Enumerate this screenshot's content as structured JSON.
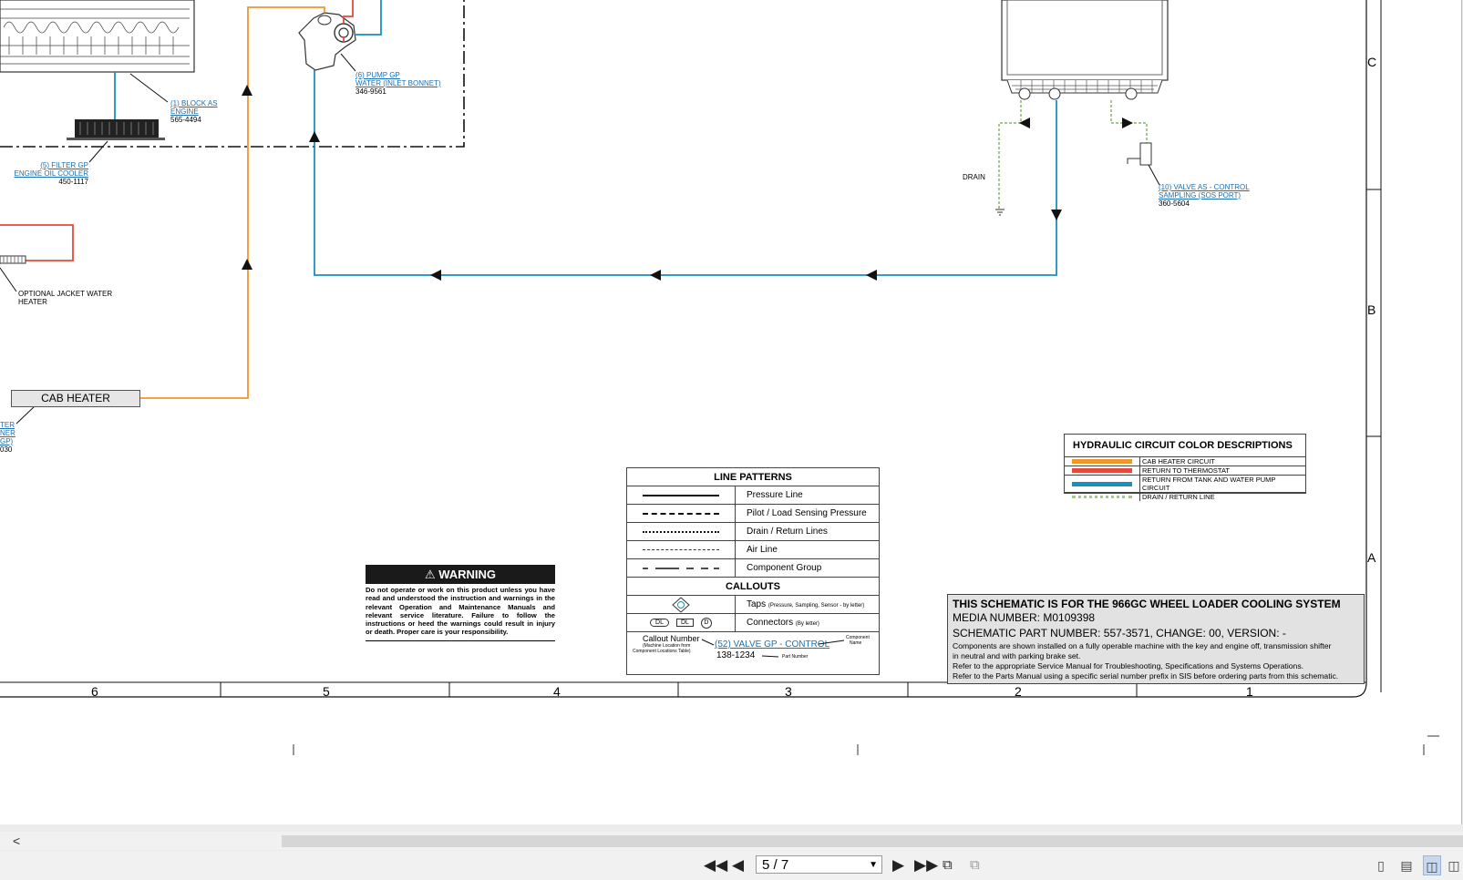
{
  "schematic": {
    "callouts": {
      "block": {
        "link": "(1) BLOCK AS",
        "link2": "ENGINE",
        "part": "565-4494"
      },
      "pump": {
        "link": "(6) PUMP GP",
        "link2": "WATER (INLET BONNET)",
        "part": "346-9561"
      },
      "filter": {
        "link": "(5) FILTER GP",
        "link2": "ENGINE OIL COOLER",
        "part": "450-1117"
      },
      "valve": {
        "link": "(10) VALVE AS - CONTROL",
        "link2": "SAMPLING (SOS PORT)",
        "part": "360-5604"
      },
      "cab_partial": {
        "l1": "TER",
        "l2": "NER",
        "l3": "GP)",
        "part": "030"
      }
    },
    "labels": {
      "drain": "DRAIN",
      "jacket_heater_1": "OPTIONAL JACKET WATER",
      "jacket_heater_2": "HEATER",
      "cab_heater": "CAB HEATER"
    },
    "zones": {
      "letters": [
        "C",
        "B",
        "A"
      ],
      "numbers": [
        "6",
        "5",
        "4",
        "3",
        "2",
        "1"
      ]
    },
    "colors": {
      "cab_heater_circuit": "#f0962b",
      "return_to_thermostat": "#e04b3c",
      "return_from_tank": "#1b8fbd",
      "drain_return": "#a6c78f"
    }
  },
  "color_legend": {
    "title": "HYDRAULIC CIRCUIT COLOR DESCRIPTIONS",
    "items": [
      {
        "label": "CAB HEATER CIRCUIT",
        "color": "#f0962b"
      },
      {
        "label": "RETURN TO THERMOSTAT",
        "color": "#e04b3c"
      },
      {
        "label": "RETURN FROM TANK AND WATER PUMP CIRCUIT",
        "color": "#1b8fbd"
      },
      {
        "label": "DRAIN / RETURN LINE",
        "color": "#a6c78f"
      }
    ]
  },
  "line_patterns": {
    "title": "LINE PATTERNS",
    "rows": [
      "Pressure Line",
      "Pilot / Load Sensing Pressure",
      "Drain / Return Lines",
      "Air Line",
      "Component Group"
    ],
    "callouts_title": "CALLOUTS",
    "taps": "Taps",
    "taps_note": "(Pressure, Sampling, Sensor - by letter)",
    "connectors": "Connectors",
    "connectors_note": "(By letter)",
    "conn_dl": "DL",
    "conn_d": "D",
    "example": {
      "callout_number": "Callout Number",
      "machine_location": "(Machine Location from",
      "component_table": "Component Locations Table)",
      "link": "(52) VALVE GP - CONTROL",
      "component": "Component",
      "name": "Name",
      "part": "138-1234",
      "part_label": "Part Number"
    }
  },
  "warning": {
    "title": "WARNING",
    "text": "Do not operate or work on this product unless you have read and understood the instruction and warnings in the relevant Operation and Maintenance Manuals and relevant service literature. Failure to follow the instructions or heed the warnings could result in injury or death. Proper care is your responsibility."
  },
  "title_block": {
    "line1": "THIS SCHEMATIC IS FOR THE  966GC WHEEL LOADER COOLING SYSTEM",
    "line2": "MEDIA NUMBER: M0109398",
    "line3": "SCHEMATIC PART NUMBER: 557-3571, CHANGE: 00, VERSION: -",
    "line4": "Components are shown installed on a fully operable machine with the key and engine off, transmission shifter",
    "line5": "in neutral and with parking brake set.",
    "line6": "Refer to the appropriate Service Manual for Troubleshooting, Specifications and Systems Operations.",
    "line7": "Refer to the Parts Manual using a specific serial number prefix in SIS before ordering parts from this schematic."
  },
  "toolbar": {
    "first_page": "first-page-icon",
    "prev_page": "prev-page-icon",
    "page_value": "5 / 7",
    "next_page": "next-page-icon",
    "last_page": "last-page-icon",
    "views": [
      "single-page-icon",
      "continuous-icon",
      "two-page-icon",
      "two-page-continuous-icon"
    ]
  },
  "scrollbar": {
    "left_arrow": "<"
  }
}
